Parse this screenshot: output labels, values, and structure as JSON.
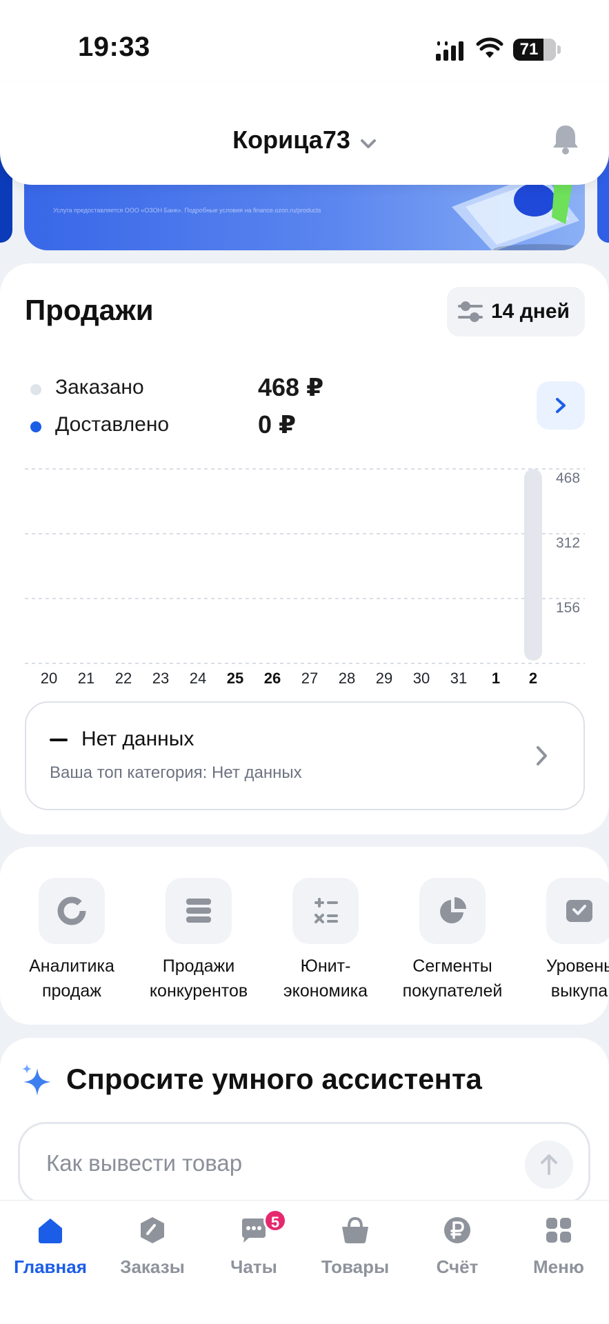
{
  "status_bar": {
    "time": "19:33",
    "battery": "71",
    "battery_level": 0.71
  },
  "banner": {
    "legal": "Услуга предоставляется ООО «ОЗОН Банк». Подробные условия на finance.ozon.ru/products"
  },
  "header": {
    "store_name": "Корица73"
  },
  "sales": {
    "title": "Продажи",
    "period_label": "14 дней",
    "legend": [
      {
        "label": "Заказано",
        "value": "468 ₽",
        "color": "#dfe3ea"
      },
      {
        "label": "Доставлено",
        "value": "0 ₽",
        "color": "#1c5de8"
      }
    ],
    "top_category": {
      "title": "Нет данных",
      "subtitle": "Ваша топ категория: Нет данных"
    }
  },
  "chart_data": {
    "type": "bar",
    "categories": [
      "20",
      "21",
      "22",
      "23",
      "24",
      "25",
      "26",
      "27",
      "28",
      "29",
      "30",
      "31",
      "1",
      "2"
    ],
    "bold_categories": [
      "25",
      "26",
      "1",
      "2"
    ],
    "series": [
      {
        "name": "Заказано",
        "values": [
          0,
          0,
          0,
          0,
          0,
          0,
          0,
          0,
          0,
          0,
          0,
          0,
          0,
          468
        ]
      },
      {
        "name": "Доставлено",
        "values": [
          0,
          0,
          0,
          0,
          0,
          0,
          0,
          0,
          0,
          0,
          0,
          0,
          0,
          0
        ]
      }
    ],
    "y_ticks": [
      "468",
      "312",
      "156"
    ],
    "ylim": [
      0,
      468
    ],
    "grid": true
  },
  "tools": [
    {
      "label": "Аналитика\nпродаж",
      "icon": "donut-icon"
    },
    {
      "label": "Продажи\nконкурентов",
      "icon": "stack-icon"
    },
    {
      "label": "Юнит-\nэкономика",
      "icon": "calculator-icon"
    },
    {
      "label": "Сегменты\nпокупателей",
      "icon": "pie-icon"
    },
    {
      "label": "Уровень\nвыкупа",
      "icon": "box-check-icon"
    }
  ],
  "assistant": {
    "title": "Спросите умного ассистента",
    "placeholder": "Как вывести товар"
  },
  "tabbar": {
    "tabs": [
      {
        "label": "Главная",
        "icon": "home-icon"
      },
      {
        "label": "Заказы",
        "icon": "orders-box-icon"
      },
      {
        "label": "Чаты",
        "icon": "chat-icon"
      },
      {
        "label": "Товары",
        "icon": "basket-icon"
      },
      {
        "label": "Счёт",
        "icon": "ruble-icon"
      },
      {
        "label": "Меню",
        "icon": "grid-menu-icon"
      }
    ],
    "chats_badge": "5",
    "active_color": "#1c5de8",
    "inactive_color": "#8e939c"
  }
}
